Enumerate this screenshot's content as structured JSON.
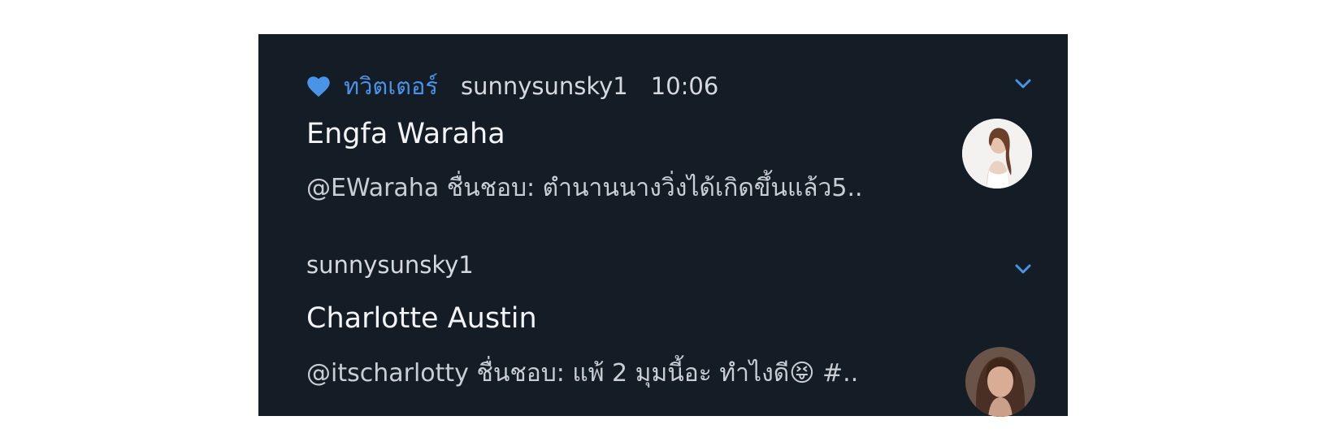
{
  "notifications": [
    {
      "app_name": "ทวิตเตอร์",
      "app_icon": "heart-icon",
      "username": "sunnysunsky1",
      "time": "10:06",
      "title": "Engfa Waraha",
      "body": "@EWaraha ชื่นชอบ: ตำนานนางวิ่งได้เกิดขึ้นแล้ว5.."
    },
    {
      "app_name": "",
      "username": "sunnysunsky1",
      "time": "",
      "title": "Charlotte Austin",
      "body": "@itscharlotty ชื่นชอบ: แพ้ 2 มุมนี้อะ ทำไงดี😝 #.."
    }
  ],
  "colors": {
    "panel_bg": "#141c26",
    "accent": "#4a93e6",
    "title": "#f2f4f6",
    "meta": "#d5d9de"
  }
}
